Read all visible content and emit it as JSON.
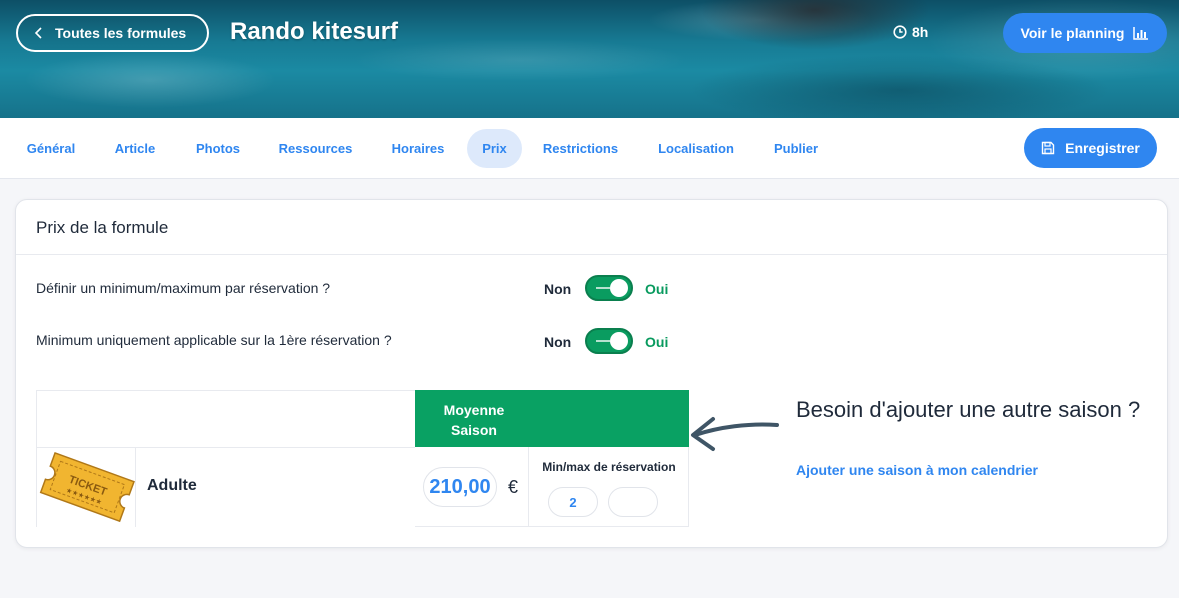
{
  "header": {
    "back_label": "Toutes les formules",
    "title": "Rando kitesurf",
    "duration": "8h",
    "planning_label": "Voir le planning"
  },
  "tabs": [
    {
      "label": "Général",
      "active": false
    },
    {
      "label": "Article",
      "active": false
    },
    {
      "label": "Photos",
      "active": false
    },
    {
      "label": "Ressources",
      "active": false
    },
    {
      "label": "Horaires",
      "active": false
    },
    {
      "label": "Prix",
      "active": true
    },
    {
      "label": "Restrictions",
      "active": false
    },
    {
      "label": "Localisation",
      "active": false
    },
    {
      "label": "Publier",
      "active": false
    }
  ],
  "save_label": "Enregistrer",
  "card": {
    "title": "Prix de la formule",
    "options": [
      {
        "label": "Définir un minimum/maximum par réservation ?",
        "off_label": "Non",
        "on_label": "Oui",
        "enabled": true
      },
      {
        "label": "Minimum uniquement applicable sur la 1ère réservation ?",
        "off_label": "Non",
        "on_label": "Oui",
        "enabled": true
      }
    ],
    "grid": {
      "season_header": "Moyenne Saison",
      "image_label": "TICKET",
      "category": "Adulte",
      "price": "210,00",
      "currency": "€",
      "minmax_label": "Min/max de réservation",
      "min_value": "2",
      "max_value": ""
    }
  },
  "help": {
    "title": "Besoin d'ajouter une autre saison ?",
    "link": "Ajouter une saison à mon calendrier"
  },
  "colors": {
    "primary": "#2f86f0",
    "success": "#09a163",
    "active_tab_bg": "#dde9fb"
  }
}
